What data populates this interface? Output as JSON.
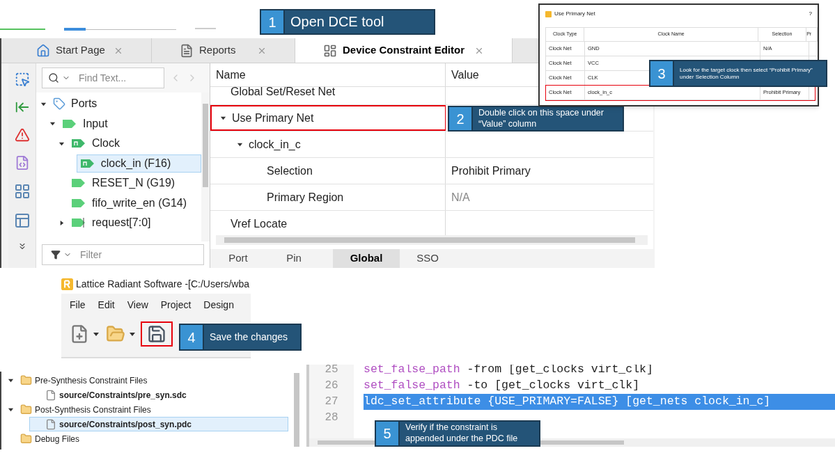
{
  "steps": [
    {
      "number": "1",
      "text": "Open DCE tool"
    },
    {
      "number": "2",
      "text": "Double click on this space under “Value” column"
    },
    {
      "number": "3",
      "text": "Look for the target clock then select “Prohibit Primary” under Selection Column"
    },
    {
      "number": "4",
      "text": "Save the changes"
    },
    {
      "number": "5",
      "text": "Verify if the constraint is appended under the PDC file"
    }
  ],
  "dce": {
    "tabs": [
      {
        "label": "Start Page",
        "selected": false
      },
      {
        "label": "Reports",
        "selected": false
      },
      {
        "label": "Device Constraint Editor",
        "selected": true
      }
    ],
    "search": {
      "placeholder": "Find Text..."
    },
    "tree": [
      {
        "label": "Ports",
        "kind": "group",
        "expanded": true,
        "selected": false,
        "children": [
          {
            "label": "Input",
            "kind": "port",
            "expanded": true,
            "selected": false,
            "children": [
              {
                "label": "Clock",
                "kind": "clock",
                "expanded": true,
                "selected": false,
                "children": [
                  {
                    "label": "clock_in (F16)",
                    "kind": "clock",
                    "selected": true
                  }
                ]
              },
              {
                "label": "RESET_N (G19)",
                "kind": "port",
                "selected": false
              },
              {
                "label": "fifo_write_en (G14)",
                "kind": "port",
                "selected": false
              },
              {
                "label": "request[7:0]",
                "kind": "bus",
                "expanded": false,
                "selected": false
              }
            ]
          }
        ]
      }
    ],
    "filter": {
      "placeholder": "Filter"
    },
    "columns": [
      "Name",
      "Value"
    ],
    "rows": [
      {
        "name": "Global Set/Reset Net",
        "highlighted": false
      },
      {
        "name": "Use Primary Net",
        "expanded": true,
        "highlighted": true,
        "children": [
          {
            "name": "clock_in_c",
            "expanded": true,
            "highlighted": false,
            "children": [
              {
                "name": "Selection",
                "value": "Prohibit Primary",
                "disabled": false,
                "highlighted": false
              },
              {
                "name": "Primary Region",
                "value": "N/A",
                "disabled": true,
                "highlighted": false
              }
            ]
          }
        ]
      },
      {
        "name": "Vref Locate",
        "highlighted": false
      }
    ],
    "bottom_tabs": [
      {
        "label": "Port",
        "selected": false
      },
      {
        "label": "Pin",
        "selected": false
      },
      {
        "label": "Global",
        "selected": true
      },
      {
        "label": "SSO",
        "selected": false
      }
    ]
  },
  "dialog": {
    "title": "Use Primary Net",
    "help": "?",
    "columns": [
      "Clock Type",
      "Clock Name",
      "Selection",
      "Pr"
    ],
    "rows": [
      {
        "cells": [
          "Clock Net",
          "GND",
          "N/A"
        ],
        "highlighted": false
      },
      {
        "cells": [
          "Clock Net",
          "VCC",
          ""
        ],
        "highlighted": false
      },
      {
        "cells": [
          "Clock Net",
          "CLK",
          ""
        ],
        "highlighted": false
      },
      {
        "cells": [
          "Clock Net",
          "clock_in_c",
          "Prohibit Primary"
        ],
        "highlighted": true
      }
    ]
  },
  "radiant": {
    "title": "Lattice Radiant Software -[C:/Users/wba",
    "menu": [
      "File",
      "Edit",
      "View",
      "Project",
      "Design"
    ],
    "tools": [
      {
        "dropdown": true,
        "highlighted": false
      },
      {
        "dropdown": true,
        "highlighted": false
      },
      {
        "dropdown": false,
        "highlighted": true
      }
    ]
  },
  "files": [
    {
      "label": "Pre-Synthesis Constraint Files",
      "expanded": true,
      "selected": false,
      "children": [
        {
          "label": "source/Constraints/pre_syn.sdc",
          "selected": false
        }
      ]
    },
    {
      "label": "Post-Synthesis Constraint Files",
      "expanded": true,
      "selected": false,
      "children": [
        {
          "label": "source/Constraints/post_syn.pdc",
          "selected": true
        }
      ]
    },
    {
      "label": "Debug Files",
      "selected": false
    }
  ],
  "code": [
    {
      "number": "25",
      "keyword": "set_false_path",
      "rest": " -from [get_clocks virt_clk]",
      "selected": false
    },
    {
      "number": "26",
      "keyword": "set_false_path",
      "rest": " -to [get_clocks virt_clk]",
      "selected": false
    },
    {
      "number": "27",
      "rest": "ldc_set_attribute {USE_PRIMARY=FALSE} [get_nets clock_in_c]",
      "selected": true
    },
    {
      "number": "28",
      "selected": false
    }
  ]
}
